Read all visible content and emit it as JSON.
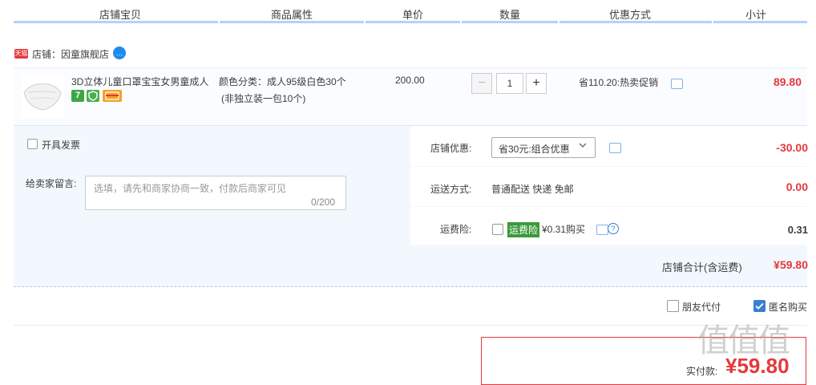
{
  "header": {
    "columns": [
      "店铺宝贝",
      "商品属性",
      "单价",
      "数量",
      "优惠方式",
      "小计"
    ]
  },
  "shop": {
    "tag": "天猫",
    "name": "店铺：因童旗舰店"
  },
  "item": {
    "title": "3D立体儿童口罩宝宝女男童成人",
    "badge_7": "7",
    "attr_line1": "颜色分类：成人95级白色30个",
    "attr_line2": "(非独立装一包10个)",
    "unit_price": "200.00",
    "qty_minus": "−",
    "quantity": "1",
    "qty_plus": "+",
    "promo": "省110.20:热卖促销",
    "subtotal": "89.80"
  },
  "invoice": {
    "label": "开具发票"
  },
  "message": {
    "label": "给卖家留言:",
    "placeholder": "选填，请先和商家协商一致，付款后商家可见",
    "count": "0/200"
  },
  "shop_discount": {
    "label": "店铺优惠:",
    "selected": "省30元:组合优惠",
    "value": "-30.00"
  },
  "shipping": {
    "label": "运送方式:",
    "text": "普通配送 快递 免邮",
    "value": "0.00"
  },
  "insurance": {
    "label": "运费险:",
    "badge": "运费险",
    "text": "¥0.31购买",
    "value": "0.31"
  },
  "shop_total": {
    "label": "店铺合计(含运费)",
    "value": "¥59.80"
  },
  "options": {
    "friend_pay": "朋友代付",
    "anonymous": "匿名购买"
  },
  "payment": {
    "label": "实付款:",
    "value": "¥59.80"
  },
  "watermark": "值值值",
  "colors": {
    "accent_red": "#e4393c",
    "header_bar": "#b2d1ff",
    "panel_bg": "#f3f8fe",
    "checkbox_blue": "#3a7fd1"
  }
}
